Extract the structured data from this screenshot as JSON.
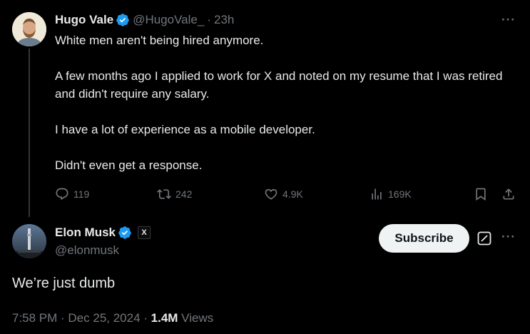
{
  "reply_parent": {
    "display_name": "Hugo Vale",
    "handle": "@HugoVale_",
    "separator": "·",
    "time_ago": "23h",
    "paragraphs": [
      "White men aren't being hired anymore.",
      "A few months ago I applied to work for X and noted on my resume that I was retired and didn't require any salary.",
      "I have a lot of experience as a mobile developer.",
      "Didn't even get a response."
    ],
    "actions": {
      "replies": "119",
      "reposts": "242",
      "likes": "4.9K",
      "views": "169K"
    }
  },
  "main_tweet": {
    "display_name": "Elon Musk",
    "handle": "@elonmusk",
    "affiliate_badge": "X",
    "subscribe_label": "Subscribe",
    "text": "We’re just dumb",
    "timestamp": "7:58 PM · Dec 25, 2024 · ",
    "view_count": "1.4M",
    "views_label": " Views"
  },
  "icons": {
    "verified": "verified-badge-icon",
    "more": "more-horizontal-icon",
    "reply": "reply-icon",
    "repost": "repost-icon",
    "like": "heart-icon",
    "views": "analytics-icon",
    "bookmark": "bookmark-icon",
    "share": "share-icon",
    "grok": "grok-icon"
  },
  "colors": {
    "background": "#000000",
    "primary_text": "#e7e9ea",
    "secondary_text": "#71767b",
    "verified_blue": "#1d9bf0",
    "subscribe_bg": "#eff3f4"
  }
}
